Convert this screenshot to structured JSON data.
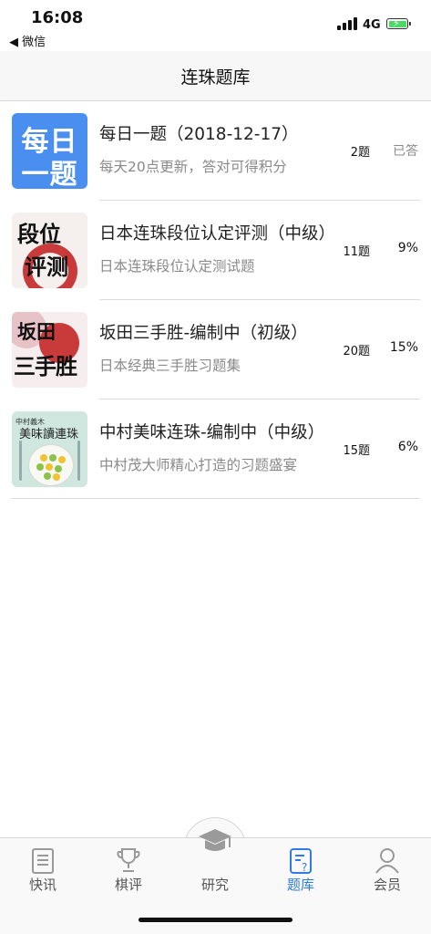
{
  "status_bar": {
    "time": "16:08",
    "back_label": "◀ 微信",
    "network": "4G"
  },
  "nav": {
    "title": "连珠题库"
  },
  "items": [
    {
      "title": "每日一题（2018-12-17）",
      "description": "每天20点更新，答对可得积分",
      "count": "2题",
      "rate": "已答",
      "thumb_lines": [
        "每日",
        "一题"
      ]
    },
    {
      "title": "日本连珠段位认定评测（中级）",
      "description": "日本连珠段位认定测试题",
      "count": "11题",
      "rate": "9%",
      "thumb_lines": [
        "段位",
        "评测"
      ]
    },
    {
      "title": "坂田三手胜-编制中（初级）",
      "description": "日本经典三手胜习题集",
      "count": "20题",
      "rate": "15%",
      "thumb_lines": [
        "坂田",
        "三手胜"
      ]
    },
    {
      "title": "中村美味连珠-编制中（中级）",
      "description": "中村茂大师精心打造的习题盛宴",
      "count": "15题",
      "rate": "6%",
      "thumb_lines": [
        "中村義木",
        "美味讀連珠"
      ]
    }
  ],
  "tabs": [
    {
      "label": "快讯",
      "icon": "newspaper-icon",
      "active": false
    },
    {
      "label": "棋评",
      "icon": "trophy-icon",
      "active": false
    },
    {
      "label": "研究",
      "icon": "graduation-cap-icon",
      "active": false
    },
    {
      "label": "题库",
      "icon": "question-doc-icon",
      "active": true
    },
    {
      "label": "会员",
      "icon": "user-icon",
      "active": false
    }
  ],
  "colors": {
    "accent": "#2f7be5",
    "daily_thumb": "#4a8ff0"
  }
}
